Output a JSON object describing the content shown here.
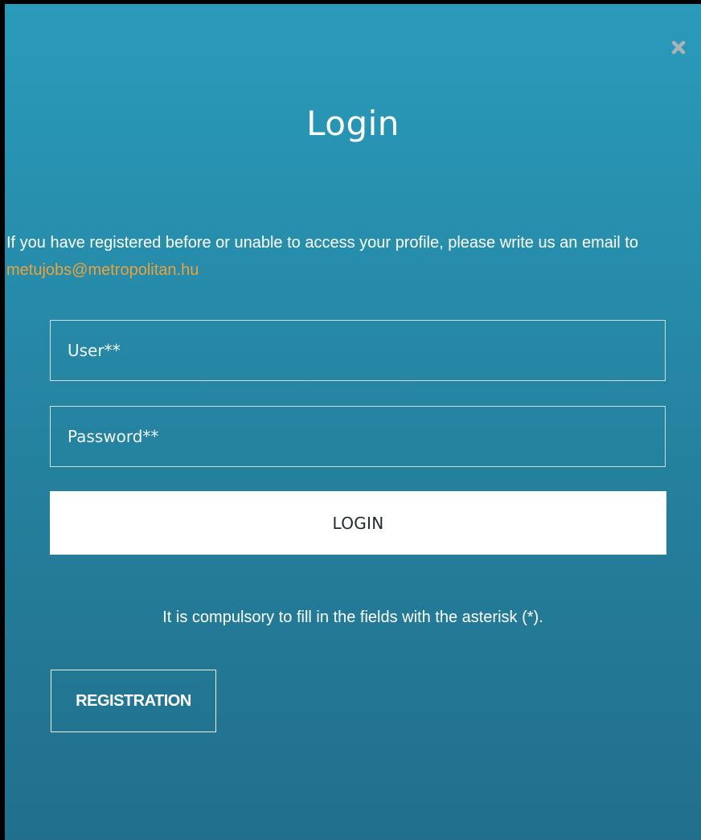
{
  "modal": {
    "close_icon": "close-x-icon",
    "title": "Login",
    "info_text": "If you have registered before or unable to access your profile, please write us an email to ",
    "email_link": "metujobs@metropolitan.hu",
    "user_placeholder": "User**",
    "user_value": "",
    "password_placeholder": "Password**",
    "password_value": "",
    "login_label": "LOGIN",
    "notice": "It is compulsory to fill in the fields with the asterisk (*).",
    "registration_label": "REGISTRATION"
  },
  "colors": {
    "background_top": "#2a9bbb",
    "background_bottom": "#216f8d",
    "link": "#e8a33c",
    "button_bg": "#ffffff",
    "button_text": "#1f2a30",
    "outer": "#000000"
  }
}
